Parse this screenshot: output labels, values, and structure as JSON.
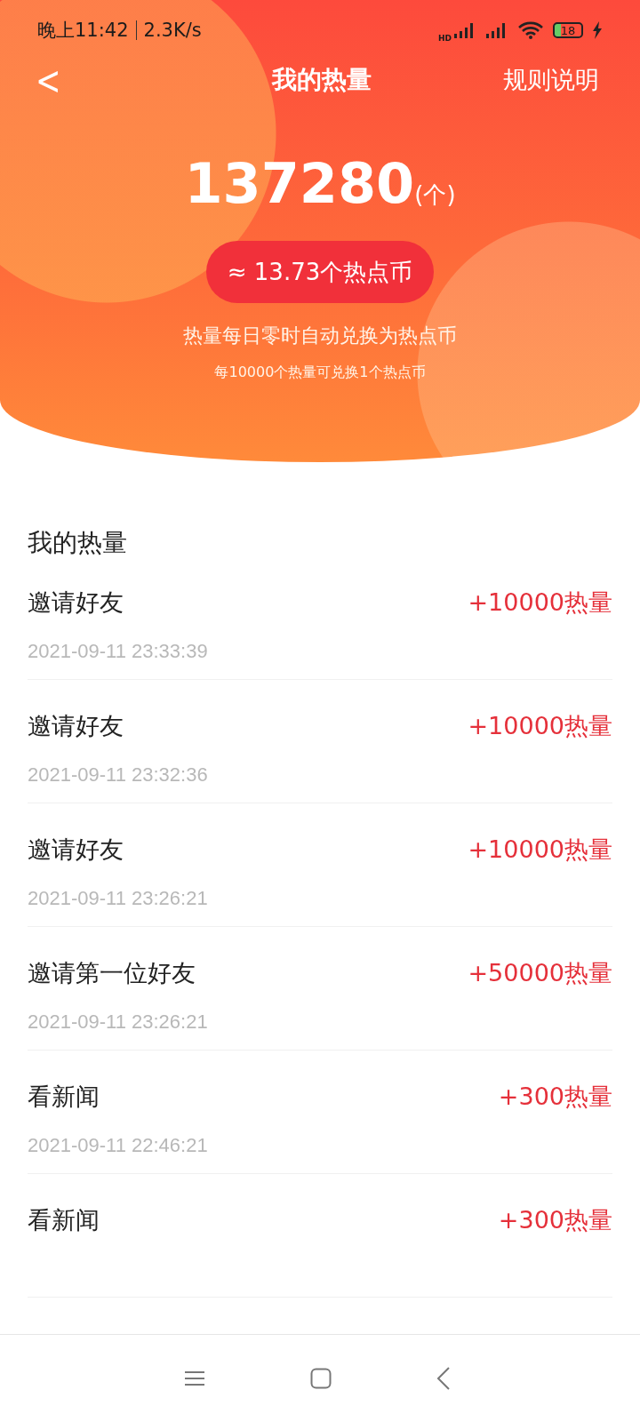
{
  "status_bar": {
    "time": "晚上11:42",
    "speed": "2.3K/s",
    "hd_label": "HD",
    "battery": "18"
  },
  "nav": {
    "back": "<",
    "title": "我的热量",
    "rules": "规则说明"
  },
  "summary": {
    "amount": "137280",
    "unit": "(个)",
    "coins": "≈ 13.73个热点币",
    "note": "热量每日零时自动兑换为热点币",
    "rate": "每10000个热量可兑换1个热点币"
  },
  "section_title": "我的热量",
  "records": [
    {
      "title": "邀请好友",
      "amount": "+10000热量",
      "time": "2021-09-11 23:33:39"
    },
    {
      "title": "邀请好友",
      "amount": "+10000热量",
      "time": "2021-09-11 23:32:36"
    },
    {
      "title": "邀请好友",
      "amount": "+10000热量",
      "time": "2021-09-11 23:26:21"
    },
    {
      "title": "邀请第一位好友",
      "amount": "+50000热量",
      "time": "2021-09-11 23:26:21"
    },
    {
      "title": "看新闻",
      "amount": "+300热量",
      "time": "2021-09-11 22:46:21"
    },
    {
      "title": "看新闻",
      "amount": "+300热量"
    }
  ]
}
